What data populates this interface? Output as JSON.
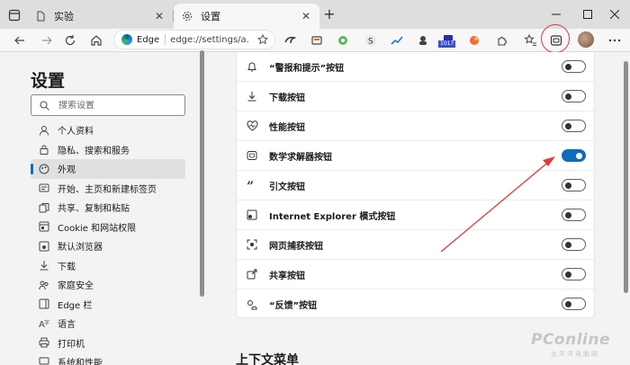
{
  "browser": {
    "tabs": [
      {
        "title": "实验",
        "icon": "document-icon",
        "active": false
      },
      {
        "title": "设置",
        "icon": "gear-icon",
        "active": true
      }
    ],
    "new_tab_label": "+",
    "close_glyph": "✕"
  },
  "toolbar": {
    "address_site": "Edge",
    "address_url": "edge://settings/a...",
    "extension_badge": "1017",
    "extensions": [
      "extension-icon",
      "extension-icon",
      "extension-icon",
      "extension-icon",
      "extension-icon",
      "extension-icon",
      "extension-icon",
      "extension-icon"
    ]
  },
  "sidebar": {
    "title": "设置",
    "search_placeholder": "搜索设置",
    "items": [
      {
        "label": "个人资料",
        "icon": "person-icon",
        "selected": false
      },
      {
        "label": "隐私、搜索和服务",
        "icon": "lock-icon",
        "selected": false
      },
      {
        "label": "外观",
        "icon": "appearance-icon",
        "selected": true
      },
      {
        "label": "开始、主页和新建标签页",
        "icon": "home-icon",
        "selected": false
      },
      {
        "label": "共享、复制和粘贴",
        "icon": "share-icon",
        "selected": false
      },
      {
        "label": "Cookie 和网站权限",
        "icon": "cookie-icon",
        "selected": false
      },
      {
        "label": "默认浏览器",
        "icon": "browser-icon",
        "selected": false
      },
      {
        "label": "下载",
        "icon": "download-icon",
        "selected": false
      },
      {
        "label": "家庭安全",
        "icon": "family-icon",
        "selected": false
      },
      {
        "label": "Edge 栏",
        "icon": "edge-bar-icon",
        "selected": false
      },
      {
        "label": "语言",
        "icon": "language-icon",
        "selected": false
      },
      {
        "label": "打印机",
        "icon": "printer-icon",
        "selected": false
      },
      {
        "label": "系统和性能",
        "icon": "system-icon",
        "selected": false
      }
    ]
  },
  "main": {
    "rows": [
      {
        "label": "“警报和提示”按钮",
        "icon": "bell-icon",
        "enabled": false
      },
      {
        "label": "下载按钮",
        "icon": "download-icon",
        "enabled": false
      },
      {
        "label": "性能按钮",
        "icon": "heart-pulse-icon",
        "enabled": false
      },
      {
        "label": "数学求解器按钮",
        "icon": "math-solver-icon",
        "enabled": true
      },
      {
        "label": "引文按钮",
        "icon": "quote-icon",
        "enabled": false
      },
      {
        "label": "Internet Explorer 模式按钮",
        "icon": "ie-mode-icon",
        "enabled": false
      },
      {
        "label": "网页捕获按钮",
        "icon": "web-capture-icon",
        "enabled": false
      },
      {
        "label": "共享按钮",
        "icon": "share-icon",
        "enabled": false
      },
      {
        "label": "“反馈”按钮",
        "icon": "feedback-icon",
        "enabled": false
      }
    ],
    "next_section_title": "上下文菜单"
  },
  "watermark": {
    "brand": "PConline",
    "sub": "太平洋电脑网"
  },
  "colors": {
    "accent": "#0f6cbd",
    "annotation": "#e03a3a"
  }
}
